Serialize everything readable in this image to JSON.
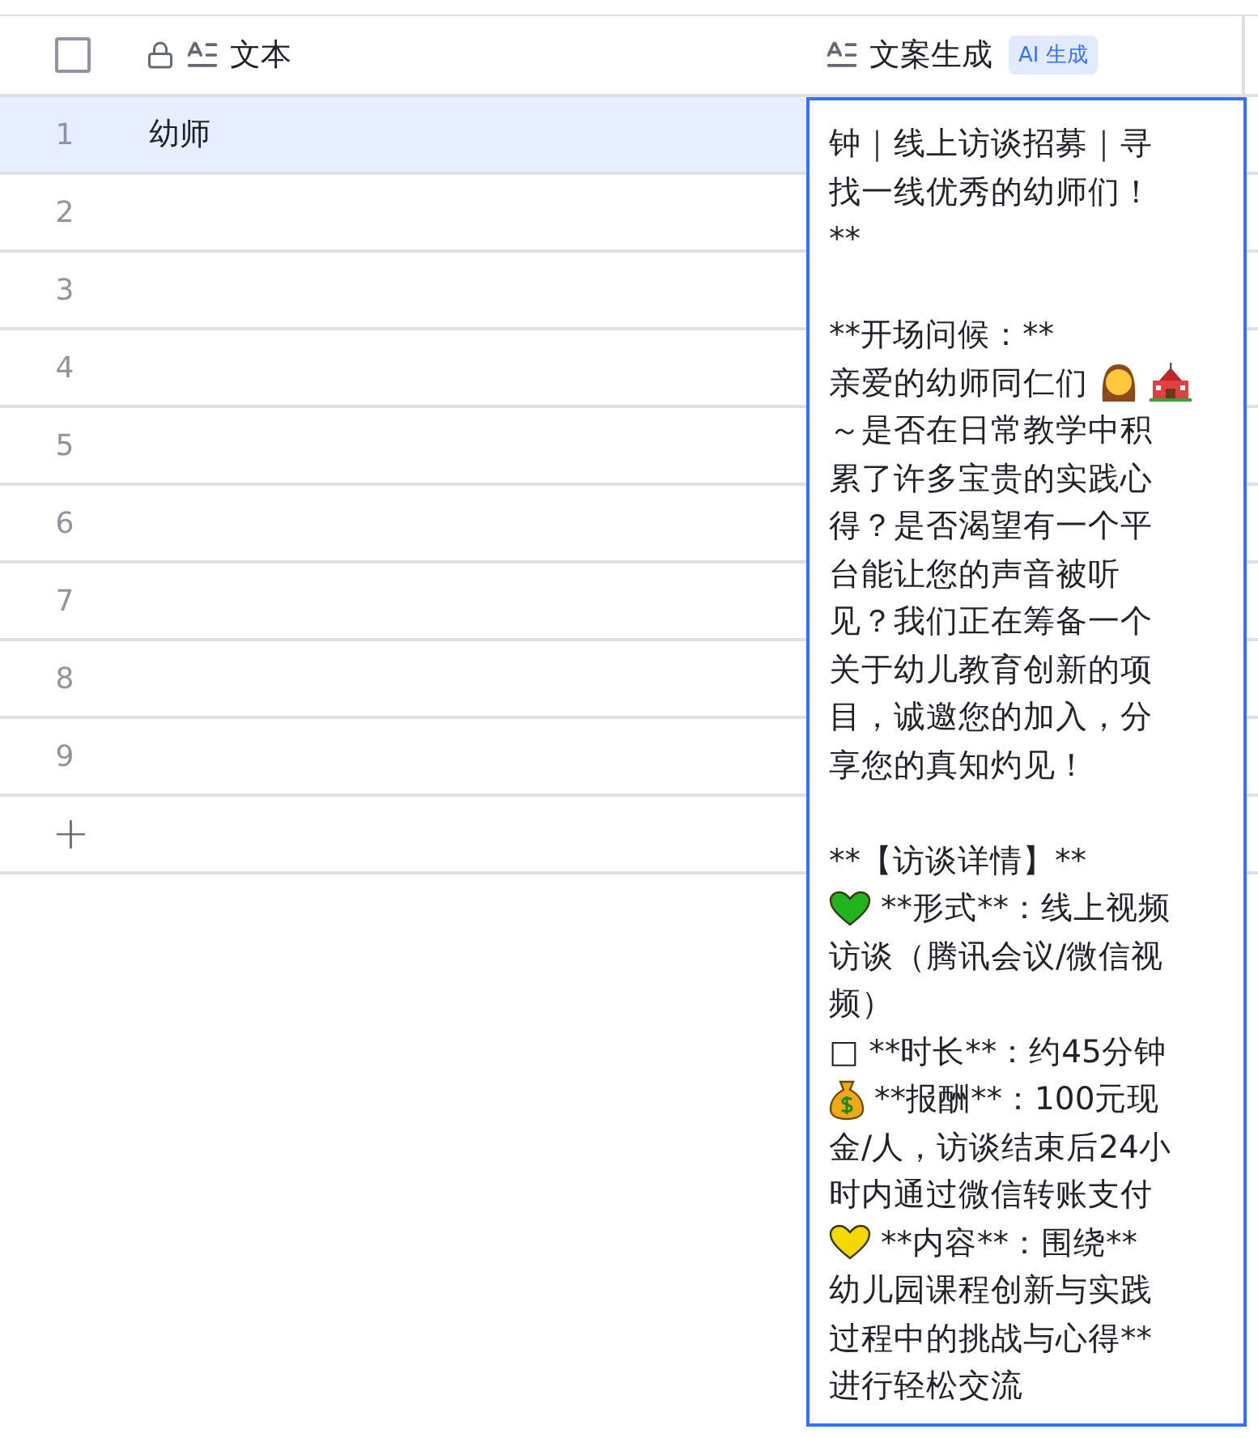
{
  "header": {
    "columns": [
      {
        "kind": "checkbox",
        "checked": false
      },
      {
        "kind": "text",
        "label": "文本",
        "locked": true
      },
      {
        "kind": "text",
        "label": "文案生成",
        "badge": "AI 生成",
        "locked": false
      }
    ]
  },
  "rows": [
    {
      "number": "1",
      "text": "幼师",
      "selected": true
    },
    {
      "number": "2",
      "text": "",
      "selected": false
    },
    {
      "number": "3",
      "text": "",
      "selected": false
    },
    {
      "number": "4",
      "text": "",
      "selected": false
    },
    {
      "number": "5",
      "text": "",
      "selected": false
    },
    {
      "number": "6",
      "text": "",
      "selected": false
    },
    {
      "number": "7",
      "text": "",
      "selected": false
    },
    {
      "number": "8",
      "text": "",
      "selected": false
    },
    {
      "number": "9",
      "text": "",
      "selected": false
    }
  ],
  "add_row": "+",
  "editor": {
    "lines": [
      {
        "kind": "text",
        "text": "钟｜线上访谈招募｜寻"
      },
      {
        "kind": "text",
        "text": "找一线优秀的幼师们！"
      },
      {
        "kind": "text",
        "text": "**"
      },
      {
        "kind": "blank"
      },
      {
        "kind": "text",
        "text": "**开场问候：**"
      },
      {
        "kind": "greeting",
        "text": "亲爱的幼师同仁们"
      },
      {
        "kind": "text",
        "text": "～是否在日常教学中积"
      },
      {
        "kind": "text",
        "text": "累了许多宝贵的实践心"
      },
      {
        "kind": "text",
        "text": "得？是否渴望有一个平"
      },
      {
        "kind": "text",
        "text": "台能让您的声音被听"
      },
      {
        "kind": "text",
        "text": "见？我们正在筹备一个"
      },
      {
        "kind": "text",
        "text": "关于幼儿教育创新的项"
      },
      {
        "kind": "text",
        "text": "目，诚邀您的加入，分"
      },
      {
        "kind": "text",
        "text": "享您的真知灼见！"
      },
      {
        "kind": "blank"
      },
      {
        "kind": "text",
        "text": "**【访谈详情】**"
      },
      {
        "kind": "heart_green",
        "text": "**形式**：线上视频"
      },
      {
        "kind": "text",
        "text": "访谈（腾讯会议/微信视"
      },
      {
        "kind": "text",
        "text": "频）"
      },
      {
        "kind": "text",
        "text": "□ **时长**：约45分钟"
      },
      {
        "kind": "money",
        "text": "**报酬**：100元现"
      },
      {
        "kind": "text",
        "text": "金/人，访谈结束后24小"
      },
      {
        "kind": "text",
        "text": "时内通过微信转账支付"
      },
      {
        "kind": "heart_yellow",
        "text": "**内容**：围绕**"
      },
      {
        "kind": "text",
        "text": "幼儿园课程创新与实践"
      },
      {
        "kind": "text",
        "text": "过程中的挑战与心得**"
      },
      {
        "kind": "text",
        "text": "进行轻松交流"
      }
    ]
  }
}
